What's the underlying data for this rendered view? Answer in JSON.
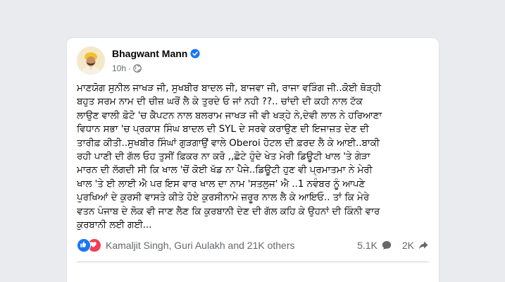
{
  "post": {
    "author": "Bhagwant Mann",
    "time": "10h",
    "body_lines": [
      "ਮਾਣਯੋਗ ਸੁਨੀਲ ਜਾਖੜ ਜੀ, ਸੁਖਬੀਰ ਬਾਦਲ ਜੀ, ਬਾਜਵਾ ਜੀ, ਰਾਜਾ ਵੜਿੰਗ ਜੀ..ਕੋਈ ਥੋੜ੍ਹੀ",
      "ਬਹੁਤ ਸਰਮ ਨਾਮ ਦੀ ਚੀਜ਼ ਘਰੋਂ ਲੈ ਕੇ ਤੁਰਦੇ ਓ ਜਾਂ ਨਹੀ ??.. ਚਾਂਦੀ ਦੀ ਕਹੀ ਨਾਲ ਟੱਕ",
      "ਲਾਉਣ ਵਾਲੀ ਫ਼ੋਟੋ 'ਚ ਕੈਪਟਨ ਨਾਲ ਬਲਰਾਮ ਜਾਖੜ ਜੀ ਵੀ ਖੜ੍ਹੇ ਨੇ,ਦੇਵੀ ਲਾਲ ਨੇ ਹਰਿਆਣਾ",
      "ਵਿਧਾਨ ਸਭਾ 'ਚ ਪ੍ਰਕਾਸ਼ ਸਿੰਘ ਬਾਦਲ ਦੀ SYL ਦੇ ਸਰਵੇ ਕਰਾਉਣ ਦੀ ਇਜਾਜ਼ਤ ਦੇਣ ਦੀ",
      "ਤਾਰੀਫ਼ ਕੀਤੀ..ਸੁਖਬੀਰ ਸਿੰਘਾਂ ਗੁੜਗਾਉਂ ਵਾਲੇ Oberoi ਹੋਟਲ ਦੀ ਫ਼ਰਦ ਲੈ ਕੇ ਆਈ..ਬਾਕੀ",
      "ਰਹੀ ਪਾਣੀ ਦੀ ਗੱਲ ਓਹ ਤੁਸੀਂ ਫ਼ਿਕਰ ਨਾ ਕਰੋ ,,ਛੋਟੇ ਹੁੰਦੇ ਖੇਤ ਮੇਰੀ ਡਿਊਟੀ ਖਾਲ 'ਤੇ ਗੇੜਾ",
      "ਮਾਰਨ ਦੀ ਲੱਗਦੀ ਸੀ ਕਿ ਖਾਲ 'ਚੋਂ ਕੋਈ ਖੱਡ ਨਾ ਪੈਜੇ..ਡਿਊਟੀ ਹੁਣ ਵੀ ਪ੍ਰਮਾਤਮਾ ਨੇ ਮੇਰੀ",
      "ਖਾਲ 'ਤੇ ਈ ਲਾਈ ਐ ਪਰ ਇਸ ਵਾਰ ਖਾਲ ਦਾ ਨਾਮ 'ਸਤਲੁਜ' ਐ ..1 ਨਵੰਬਰ ਨੂੰ ਆਪਣੇ",
      "ਪੁਰਖਿਆਂ ਦੇ ਕੁਰਸੀ ਵਾਸਤੇ ਕੀਤੇ ਹੋਏ ਕੁਰਸੀਨਾਮੇ ਜ਼ਰੂਰ ਨਾਲ ਲੈ ਕੇ ਆਇਓ.. ਤਾਂ ਕਿ ਮੇਰੇ",
      "ਵਤਨ ਪੰਜਾਬ ਦੇ ਲੋਕ ਵੀ ਜਾਣ ਲੈਣ ਕਿ ਕੁਰਬਾਨੀ ਦੇਣ ਦੀ ਗੱਲ ਕਹਿ ਕੇ ਉਹਨਾਂ ਦੀ ਕਿੰਨੀ ਵਾਰ",
      "ਕੁਰਬਾਨੀ ਲਈ ਗਈ..."
    ],
    "reactions_text": "Kamaljit Singh, Guri Aulakh and 21K others",
    "comments_count": "5.1K",
    "shares_count": "2K"
  },
  "icons": {
    "verified": "verified-badge-icon",
    "globe": "globe-icon",
    "like": "like-icon",
    "heart": "heart-icon",
    "comment": "comment-icon",
    "share": "share-icon"
  },
  "colors": {
    "brand": "#1877f2",
    "love": "#f33e58",
    "secondary_text": "#65676b"
  }
}
